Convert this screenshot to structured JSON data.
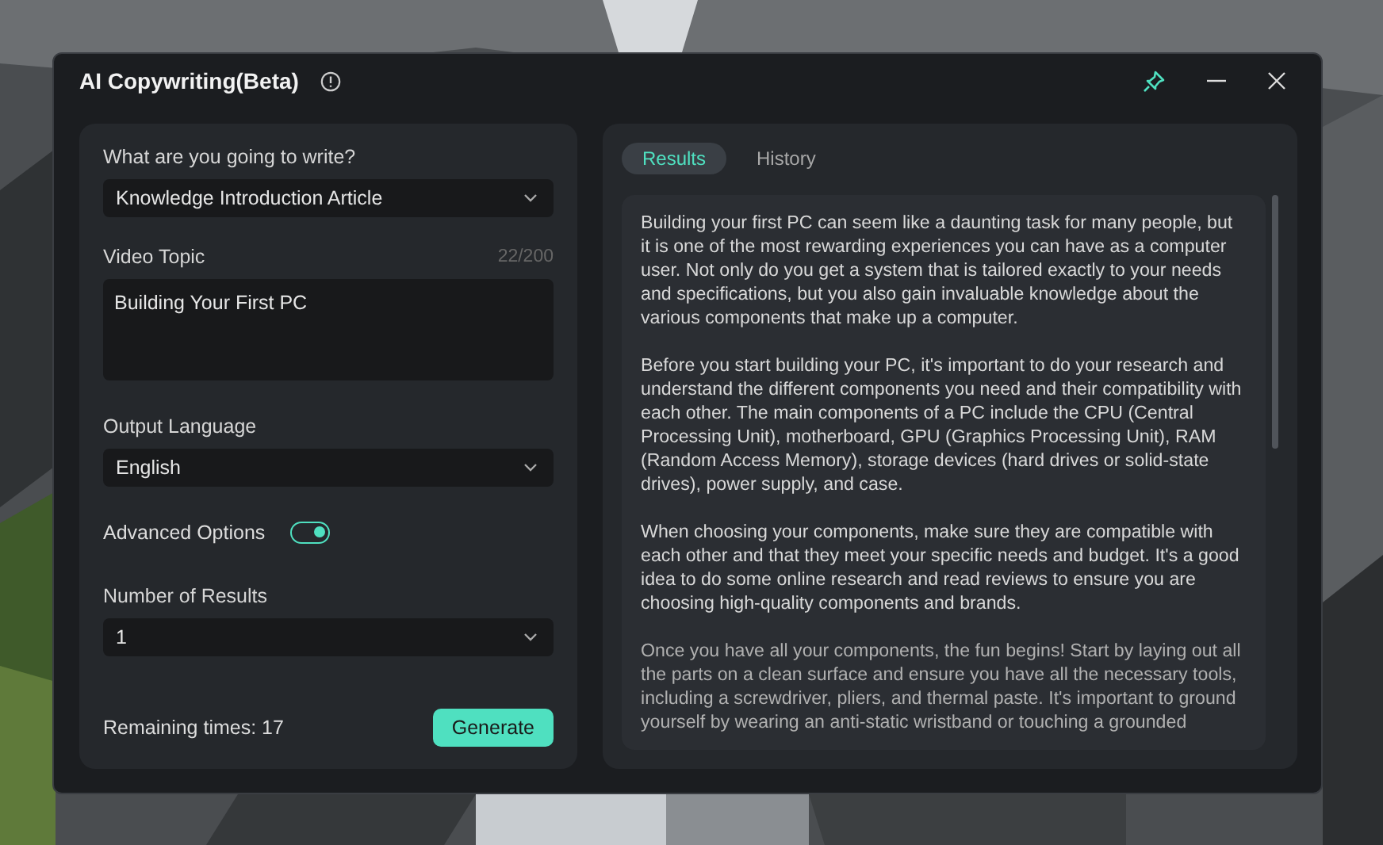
{
  "window": {
    "title": "AI Copywriting(Beta)"
  },
  "form": {
    "write_label": "What are you going to write?",
    "write_value": "Knowledge Introduction Article",
    "topic_label": "Video Topic",
    "topic_count": "22/200",
    "topic_value": "Building Your First PC",
    "language_label": "Output Language",
    "language_value": "English",
    "advanced_label": "Advanced Options",
    "advanced_on": true,
    "results_label": "Number of Results",
    "results_value": "1",
    "remaining": "Remaining times: 17",
    "generate": "Generate"
  },
  "tabs": [
    {
      "label": "Results",
      "selected": true
    },
    {
      "label": "History",
      "selected": false
    }
  ],
  "result_paragraphs": [
    "Building your first PC can seem like a daunting task for many people, but it is one of the most rewarding experiences you can have as a computer user. Not only do you get a system that is tailored exactly to your needs and specifications, but you also gain invaluable knowledge about the various components that make up a computer.",
    "Before you start building your PC, it's important to do your research and understand the different components you need and their compatibility with each other. The main components of a PC include the CPU (Central Processing Unit), motherboard, GPU (Graphics Processing Unit), RAM (Random Access Memory), storage devices (hard drives or solid-state drives), power supply, and case.",
    "When choosing your components, make sure they are compatible with each other and that they meet your specific needs and budget. It's a good idea to do some online research and read reviews to ensure you are choosing high-quality components and brands.",
    "Once you have all your components, the fun begins! Start by laying out all the parts on a clean surface and ensure you have all the necessary tools, including a screwdriver, pliers, and thermal paste. It's important to ground yourself by wearing an anti-static wristband or touching a grounded"
  ]
}
